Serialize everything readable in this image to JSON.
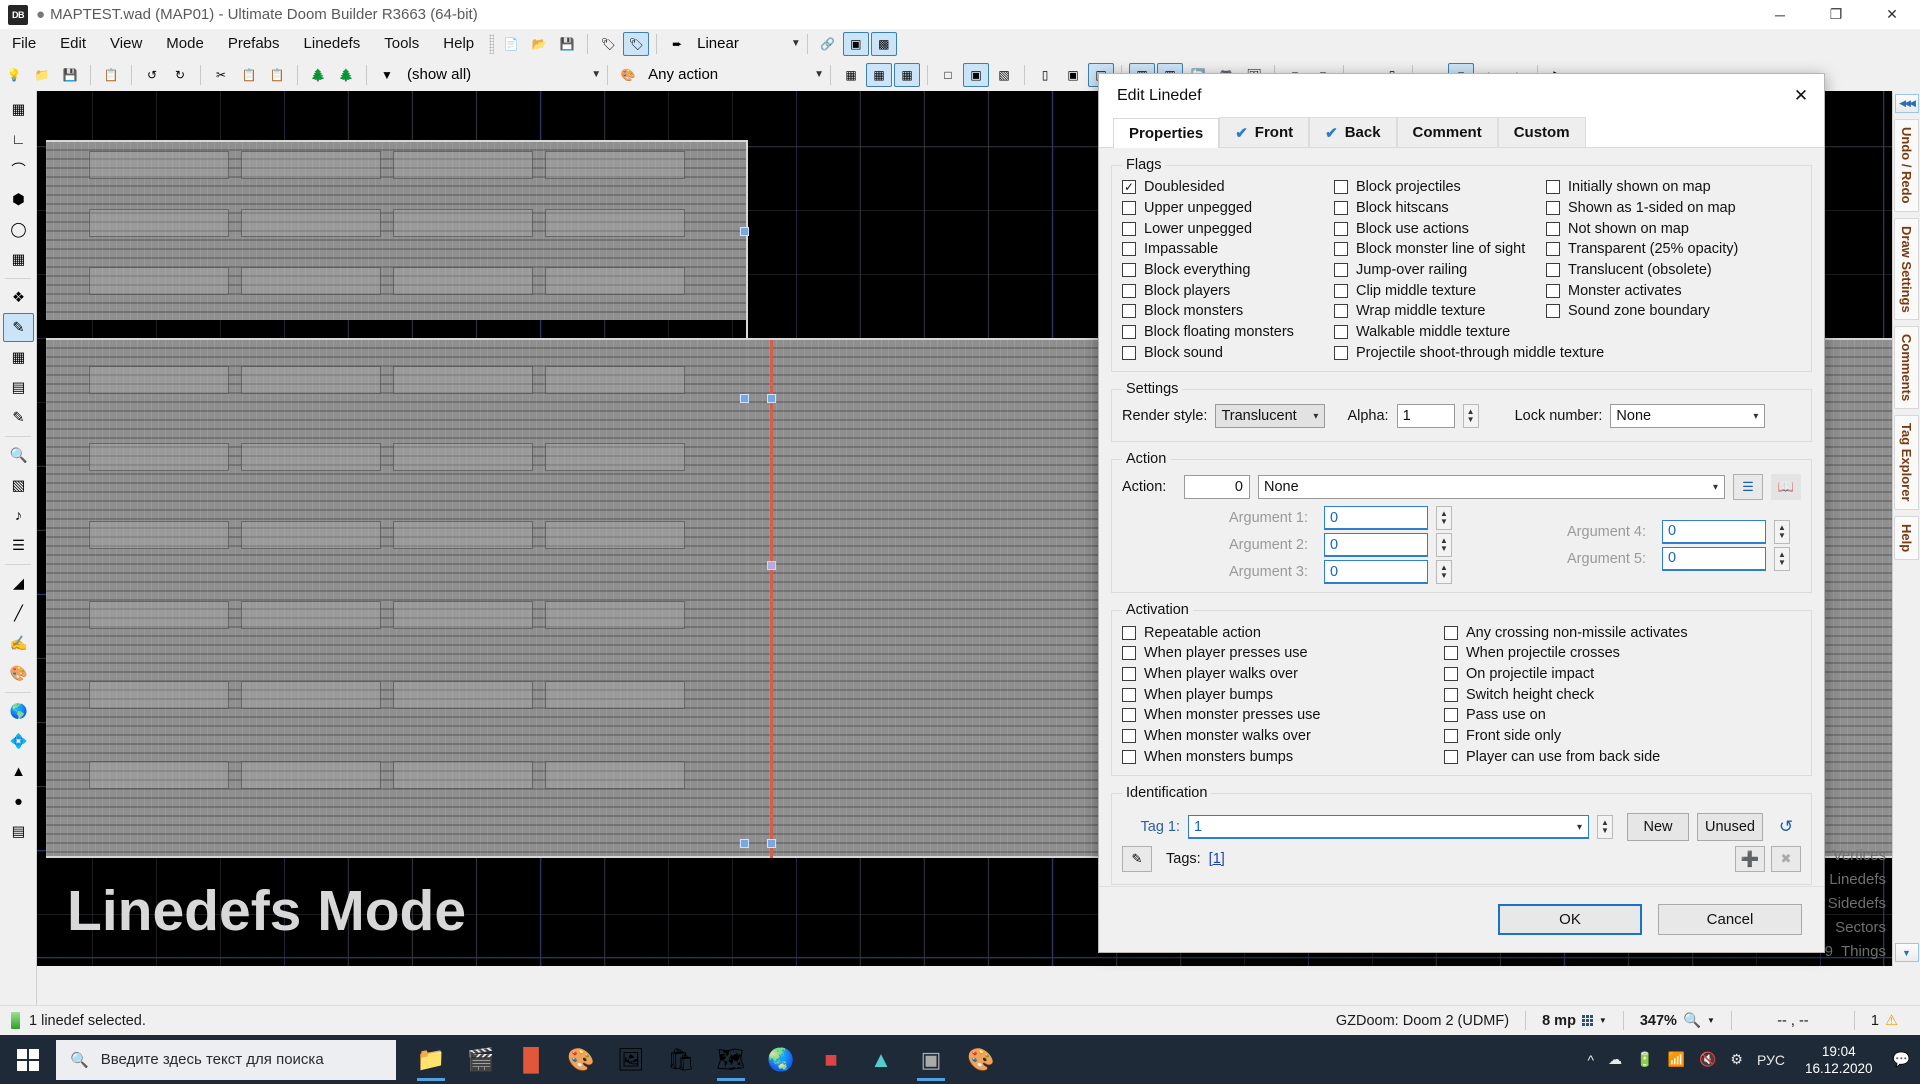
{
  "window": {
    "title": "MAPTEST.wad (MAP01) - Ultimate Doom Builder R3663 (64-bit)",
    "app_badge": "DB",
    "minimize": "─",
    "maximize": "❐",
    "close": "✕"
  },
  "menu": [
    "File",
    "Edit",
    "View",
    "Mode",
    "Prefabs",
    "Linedefs",
    "Tools",
    "Help"
  ],
  "toolbar1": {
    "mode_label": "Linear"
  },
  "toolbar2": {
    "filter_label": "(show all)",
    "action_label": "Any action"
  },
  "canvas": {
    "mode_label": "Linedefs Mode"
  },
  "right_dock": {
    "collapse": "◀◀◀",
    "expand": "▼",
    "tabs": [
      "Undo / Redo",
      "Draw Settings",
      "Comments",
      "Tag Explorer",
      "Help"
    ]
  },
  "counts": [
    {
      "num": "",
      "label": "Vertices"
    },
    {
      "num": "",
      "label": "Linedefs"
    },
    {
      "num": "",
      "label": "Sidedefs"
    },
    {
      "num": "",
      "label": "Sectors"
    },
    {
      "num": "9",
      "label": "Things"
    }
  ],
  "statusbar": {
    "message": "1 linedef selected.",
    "engine": "GZDoom: Doom 2 (UDMF)",
    "memory": "8 mp",
    "zoom": "347%",
    "coords": "-- , --",
    "warnings": "1"
  },
  "taskbar": {
    "search_placeholder": "Введите здесь текст для поиска",
    "language": "РУС",
    "time": "19:04",
    "date": "16.12.2020"
  },
  "dialog": {
    "title": "Edit Linedef",
    "close": "✕",
    "tabs": [
      {
        "label": "Properties",
        "check": false,
        "active": true
      },
      {
        "label": "Front",
        "check": true,
        "active": false
      },
      {
        "label": "Back",
        "check": true,
        "active": false
      },
      {
        "label": "Comment",
        "check": false,
        "active": false
      },
      {
        "label": "Custom",
        "check": false,
        "active": false
      }
    ],
    "flags": {
      "legend": "Flags",
      "col1": [
        {
          "label": "Doublesided",
          "checked": true
        },
        {
          "label": "Upper unpegged",
          "checked": false
        },
        {
          "label": "Lower unpegged",
          "checked": false
        },
        {
          "label": "Impassable",
          "checked": false
        },
        {
          "label": "Block everything",
          "checked": false
        },
        {
          "label": "Block players",
          "checked": false
        },
        {
          "label": "Block monsters",
          "checked": false
        },
        {
          "label": "Block floating monsters",
          "checked": false
        },
        {
          "label": "Block sound",
          "checked": false
        }
      ],
      "col2": [
        {
          "label": "Block projectiles",
          "checked": false
        },
        {
          "label": "Block hitscans",
          "checked": false
        },
        {
          "label": "Block use actions",
          "checked": false
        },
        {
          "label": "Block monster line of sight",
          "checked": false
        },
        {
          "label": "Jump-over railing",
          "checked": false
        },
        {
          "label": "Clip middle texture",
          "checked": false
        },
        {
          "label": "Wrap middle texture",
          "checked": false
        },
        {
          "label": "Walkable middle texture",
          "checked": false
        },
        {
          "label": "Projectile shoot-through middle texture",
          "checked": false
        }
      ],
      "col3": [
        {
          "label": "Initially shown on map",
          "checked": false
        },
        {
          "label": "Shown as 1-sided on map",
          "checked": false
        },
        {
          "label": "Not shown on map",
          "checked": false
        },
        {
          "label": "Transparent (25% opacity)",
          "checked": false
        },
        {
          "label": "Translucent (obsolete)",
          "checked": false
        },
        {
          "label": "Monster activates",
          "checked": false
        },
        {
          "label": "Sound zone boundary",
          "checked": false
        }
      ]
    },
    "settings": {
      "legend": "Settings",
      "render_style_label": "Render style:",
      "render_style_value": "Translucent",
      "alpha_label": "Alpha:",
      "alpha_value": "1",
      "lock_label": "Lock number:",
      "lock_value": "None"
    },
    "action": {
      "legend": "Action",
      "action_label": "Action:",
      "action_number": "0",
      "action_name": "None",
      "browse_icon": "list-icon",
      "info_icon": "book-icon",
      "args": [
        {
          "label": "Argument 1:",
          "value": "0"
        },
        {
          "label": "Argument 2:",
          "value": "0"
        },
        {
          "label": "Argument 3:",
          "value": "0"
        },
        {
          "label": "Argument 4:",
          "value": "0"
        },
        {
          "label": "Argument 5:",
          "value": "0"
        }
      ]
    },
    "activation": {
      "legend": "Activation",
      "col1": [
        {
          "label": "Repeatable action",
          "checked": false
        },
        {
          "label": "When player presses use",
          "checked": false
        },
        {
          "label": "When player walks over",
          "checked": false
        },
        {
          "label": "When player bumps",
          "checked": false
        },
        {
          "label": "When monster presses use",
          "checked": false
        },
        {
          "label": "When monster walks over",
          "checked": false
        },
        {
          "label": "When monsters bumps",
          "checked": false
        }
      ],
      "col2": [
        {
          "label": "Any crossing non-missile activates",
          "checked": false
        },
        {
          "label": "When projectile crosses",
          "checked": false
        },
        {
          "label": "On projectile impact",
          "checked": false
        },
        {
          "label": "Switch height check",
          "checked": false
        },
        {
          "label": "Pass use on",
          "checked": false
        },
        {
          "label": "Front side only",
          "checked": false
        },
        {
          "label": "Player can use from back side",
          "checked": false
        }
      ]
    },
    "identification": {
      "legend": "Identification",
      "tag_label": "Tag 1:",
      "tag_value": "1",
      "new_label": "New",
      "unused_label": "Unused",
      "reset_icon": "undo-icon",
      "erase_icon": "eraser-icon",
      "tags_label": "Tags:",
      "tags_value": "[1]",
      "add_icon": "plus-icon",
      "remove_icon": "remove-icon"
    },
    "buttons": {
      "ok": "OK",
      "cancel": "Cancel"
    }
  }
}
